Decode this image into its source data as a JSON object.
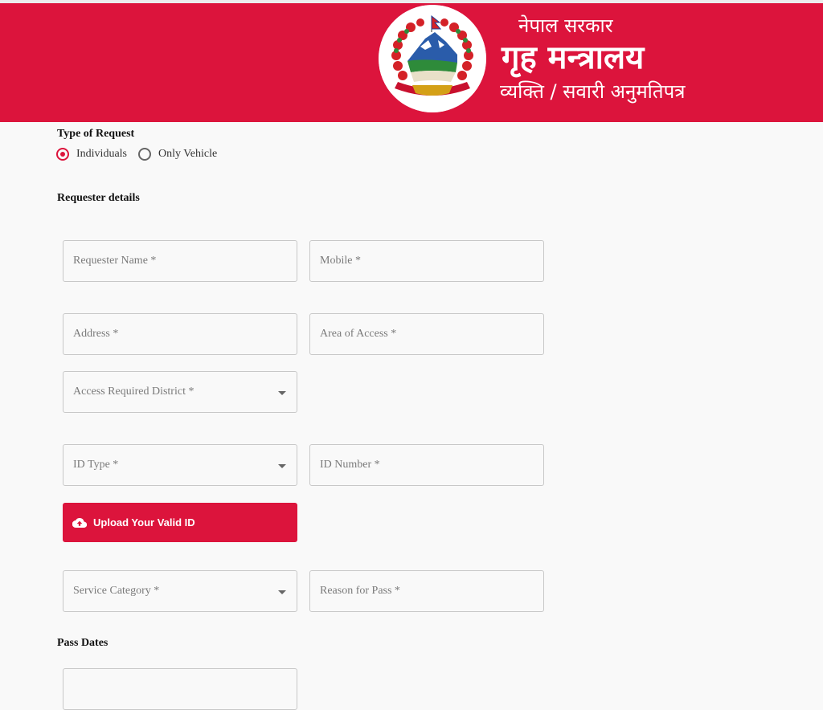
{
  "header": {
    "emblem_icon": "nepal-emblem-icon",
    "government_label": "नेपाल सरकार",
    "ministry_label": "गृह मन्त्रालय",
    "permit_label": "व्यक्ति / सवारी अनुमतिपत्र",
    "brand_color": "#dc143c"
  },
  "request_type": {
    "label": "Type of Request",
    "options": [
      {
        "label": "Individuals",
        "checked": true
      },
      {
        "label": "Only Vehicle",
        "checked": false
      }
    ]
  },
  "requester": {
    "section_label": "Requester details",
    "fields": {
      "name": {
        "placeholder": "Requester Name *",
        "value": ""
      },
      "mobile": {
        "placeholder": "Mobile *",
        "value": ""
      },
      "address": {
        "placeholder": "Address *",
        "value": ""
      },
      "area": {
        "placeholder": "Area of Access *",
        "value": ""
      },
      "district": {
        "placeholder": "Access Required District *",
        "value": ""
      },
      "id_type": {
        "placeholder": "ID Type *",
        "value": ""
      },
      "id_number": {
        "placeholder": "ID Number *",
        "value": ""
      },
      "service_category": {
        "placeholder": "Service Category *",
        "value": ""
      },
      "reason": {
        "placeholder": "Reason for Pass *",
        "value": ""
      }
    },
    "upload_button": {
      "label": "Upload Your Valid ID",
      "icon": "cloud-upload-icon"
    }
  },
  "pass_dates": {
    "section_label": "Pass Dates"
  }
}
